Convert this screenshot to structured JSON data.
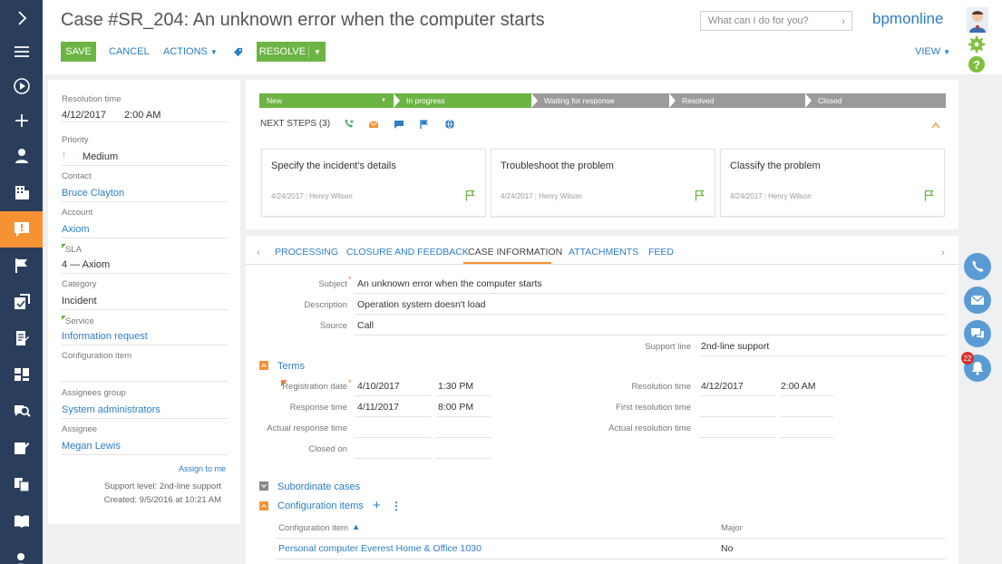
{
  "nav": {
    "items": [
      "expand",
      "menu",
      "process",
      "add",
      "contacts",
      "accounts",
      "cases",
      "activities",
      "leads",
      "documents",
      "dashboards",
      "knowledge-search",
      "orders",
      "files",
      "knowledge-base",
      "users"
    ],
    "active": "cases"
  },
  "header": {
    "title": "Case #SR_204: An unknown error when the computer starts",
    "search_placeholder": "What can I do for you?",
    "brand": "bpmonline",
    "save": "SAVE",
    "cancel": "CANCEL",
    "actions": "ACTIONS",
    "resolve": "RESOLVE",
    "view": "VIEW"
  },
  "left_panel": {
    "resolution_time_label": "Resolution time",
    "resolution_date": "4/12/2017",
    "resolution_time": "2:00 AM",
    "priority_label": "Priority",
    "priority": "Medium",
    "contact_label": "Contact",
    "contact": "Bruce Clayton",
    "account_label": "Account",
    "account": "Axiom",
    "sla_label": "SLA",
    "sla": "4 — Axiom",
    "category_label": "Category",
    "category": "Incident",
    "service_label": "Service",
    "service": "Information request",
    "config_item_label": "Configuration item",
    "config_item": "",
    "assignees_group_label": "Assignees group",
    "assignees_group": "System administrators",
    "assignee_label": "Assignee",
    "assignee": "Megan Lewis",
    "assign_to_me": "Assign to me",
    "support_level": "Support level: 2nd-line support",
    "created": "Created: 9/5/2016 at 10:21 AM"
  },
  "stages": [
    {
      "label": "New",
      "state": "done"
    },
    {
      "label": "In progress",
      "state": "done"
    },
    {
      "label": "Waiting for response",
      "state": "todo"
    },
    {
      "label": "Resolved",
      "state": "todo"
    },
    {
      "label": "Closed",
      "state": "todo"
    }
  ],
  "next_steps": {
    "label": "NEXT STEPS (3)",
    "cards": [
      {
        "title": "Specify the incident's details",
        "date": "4/24/2017",
        "user": "Henry Wilson"
      },
      {
        "title": "Troubleshoot the problem",
        "date": "4/24/2017",
        "user": "Henry Wilson"
      },
      {
        "title": "Classify the problem",
        "date": "4/24/2017",
        "user": "Henry Wilson"
      }
    ]
  },
  "tabs": [
    {
      "label": "PROCESSING",
      "active": false
    },
    {
      "label": "CLOSURE AND FEEDBACK",
      "active": false
    },
    {
      "label": "CASE INFORMATION",
      "active": true
    },
    {
      "label": "ATTACHMENTS",
      "active": false
    },
    {
      "label": "FEED",
      "active": false
    }
  ],
  "case_info": {
    "subject_label": "Subject",
    "subject": "An unknown error when the computer starts",
    "description_label": "Description",
    "description": "Operation system doesn't load",
    "source_label": "Source",
    "source": "Call",
    "support_line_label": "Support line",
    "support_line": "2nd-line support"
  },
  "terms": {
    "header": "Terms",
    "registration_date_label": "Registration date",
    "registration_date": "4/10/2017",
    "registration_time": "1:30 PM",
    "response_time_label": "Response time",
    "response_date": "4/11/2017",
    "response_time": "8:00 PM",
    "actual_response_time_label": "Actual response time",
    "closed_on_label": "Closed on",
    "resolution_time_label": "Resolution time",
    "resolution_date": "4/12/2017",
    "resolution_time": "2:00 AM",
    "first_resolution_time_label": "First resolution time",
    "actual_resolution_time_label": "Actual resolution time"
  },
  "subordinate_cases": "Subordinate cases",
  "config_items": {
    "header": "Configuration items",
    "col_item": "Configuration item",
    "col_major": "Major",
    "rows": [
      {
        "item": "Personal computer Everest Home & Office 1030",
        "major": "No"
      }
    ]
  },
  "notifications_count": "22",
  "colors": {
    "nav_bg": "#2a3e5c",
    "accent_orange": "#f59334",
    "green": "#6cb444",
    "link_blue": "#2d7dc3"
  }
}
